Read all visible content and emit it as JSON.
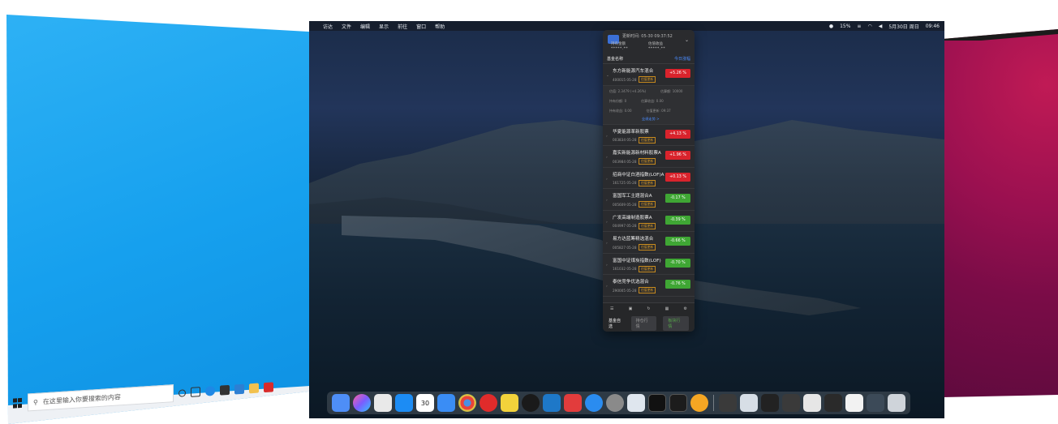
{
  "windows": {
    "search_placeholder": "在这里输入你要搜索的内容"
  },
  "mac": {
    "menubar": {
      "apple": "",
      "items": [
        "访达",
        "文件",
        "编辑",
        "显示",
        "前往",
        "窗口",
        "帮助"
      ],
      "status_cpu": "15%",
      "date": "5月30日 周日",
      "time": "09:46"
    },
    "widget": {
      "title": "更新时间: 05-30 09:37:52",
      "metric_1_label": "持有金额",
      "metric_2_label": "估值收益",
      "metric_1_value": "*****.**",
      "metric_2_value": "*****.**",
      "sort_label": "基金名称",
      "sort_right": "今日涨幅",
      "funds": [
        {
          "name": "东方新能源汽车混合",
          "code": "400015 05-28",
          "tag": "估值更新",
          "pct": "+5.26 %",
          "dir": "up"
        },
        {
          "name": "华夏能源革新股票",
          "code": "003834 05-28",
          "tag": "估值更新",
          "pct": "+4.13 %",
          "dir": "up"
        },
        {
          "name": "嘉实新能源新材料股票A",
          "code": "003984 05-28",
          "tag": "估值更新",
          "pct": "+1.96 %",
          "dir": "up"
        },
        {
          "name": "招商中证白酒指数(LOF)A",
          "code": "161725 05-28",
          "tag": "估值更新",
          "pct": "+0.13 %",
          "dir": "up"
        },
        {
          "name": "富国军工主题混合A",
          "code": "005609 05-28",
          "tag": "估值更新",
          "pct": "-0.17 %",
          "dir": "down"
        },
        {
          "name": "广发高端制造股票A",
          "code": "004997 05-28",
          "tag": "估值更新",
          "pct": "-0.39 %",
          "dir": "down"
        },
        {
          "name": "易方达蓝筹精选混合",
          "code": "005827 05-28",
          "tag": "估值更新",
          "pct": "-0.66 %",
          "dir": "down"
        },
        {
          "name": "富国中证煤炭指数(LOF)",
          "code": "161032 05-28",
          "tag": "估值更新",
          "pct": "-0.70 %",
          "dir": "down"
        },
        {
          "name": "泰信竞争优选混合",
          "code": "290005 05-28",
          "tag": "估值更新",
          "pct": "-0.76 %",
          "dir": "down"
        }
      ],
      "detail": {
        "l1": "估值: 2.3479 (+4.26%)",
        "l1b": "估算额: 10000",
        "l2": "持有份额: 0",
        "l2b": "估算收益: 0.00",
        "l3": "持有收益: 0.00",
        "l3b": "估值更新: 09:37",
        "link": "业绩走势 >"
      },
      "tabs": [
        "基金自选",
        "持仓行情",
        "板块行情"
      ]
    }
  },
  "colors": {
    "up": "#d9232c",
    "down": "#3fa634",
    "accent": "#4a8cff"
  }
}
